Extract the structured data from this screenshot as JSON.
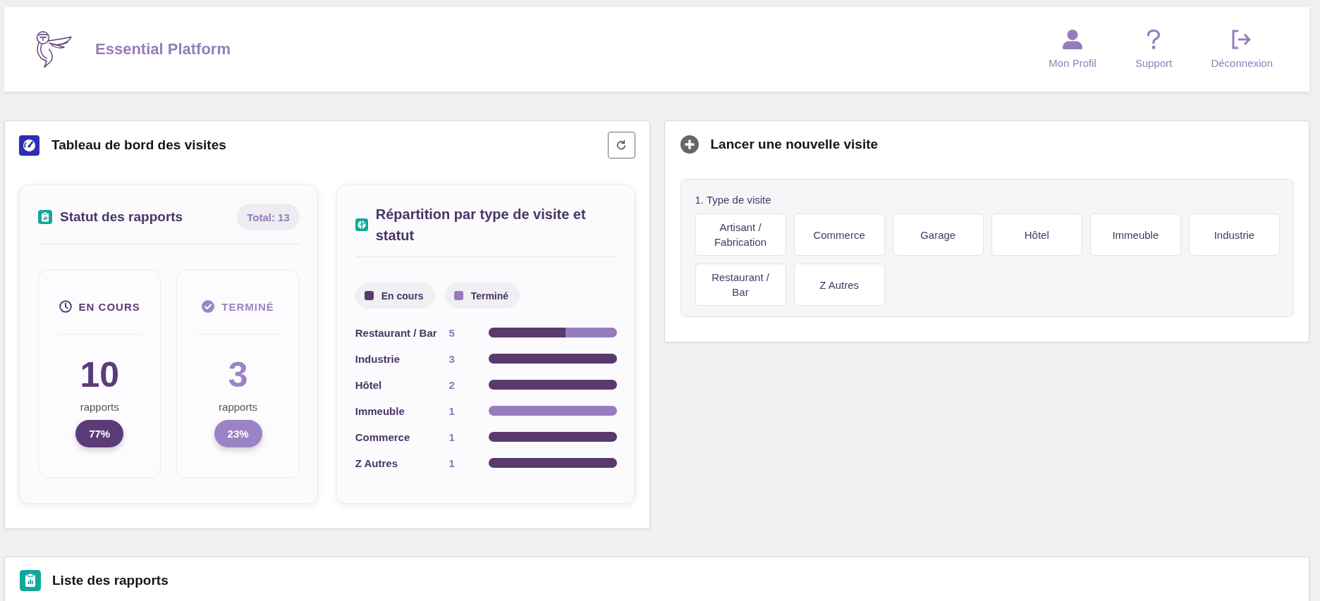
{
  "header": {
    "title": "Essential Platform",
    "nav": [
      {
        "kind": "profile",
        "label": "Mon Profil"
      },
      {
        "kind": "support",
        "label": "Support"
      },
      {
        "kind": "logout",
        "label": "Déconnexion"
      }
    ]
  },
  "dashboard": {
    "title": "Tableau de bord des visites",
    "status_panel": {
      "title": "Statut des rapports",
      "total": "Total: 13",
      "statuses": [
        {
          "kind": "in_progress",
          "label": "EN COURS",
          "count": "10",
          "unit": "rapports",
          "percent": "77%",
          "color": "#5b3c78"
        },
        {
          "kind": "done",
          "label": "TERMINÉ",
          "count": "3",
          "unit": "rapports",
          "percent": "23%",
          "color": "#9a84c5"
        }
      ]
    },
    "distribution_panel": {
      "title": "Répartition par type de visite et statut",
      "legend": [
        {
          "label": "En cours",
          "color": "#583b6c"
        },
        {
          "label": "Terminé",
          "color": "#957dbd"
        }
      ],
      "rows": [
        {
          "label": "Restaurant / Bar",
          "count": "5",
          "level": 0.6
        },
        {
          "label": "Industrie",
          "count": "3",
          "level": 1
        },
        {
          "label": "Hôtel",
          "count": "2",
          "level": 1
        },
        {
          "label": "Immeuble",
          "count": "1",
          "level": 0
        },
        {
          "label": "Commerce",
          "count": "1",
          "level": 1
        },
        {
          "label": "Z Autres",
          "count": "1",
          "level": 1
        }
      ]
    }
  },
  "new_visit": {
    "title": "Lancer une nouvelle visite",
    "step_label": "1. Type de visite",
    "options": [
      {
        "label": "Artisant / Fabrication",
        "selected": false
      },
      {
        "label": "Commerce",
        "selected": false
      },
      {
        "label": "Garage",
        "selected": false
      },
      {
        "label": "Hôtel",
        "selected": false
      },
      {
        "label": "Immeuble",
        "selected": false
      },
      {
        "label": "Industrie",
        "selected": false
      },
      {
        "label": "Restaurant / Bar",
        "selected": false
      },
      {
        "label": "Z Autres",
        "selected": false
      }
    ]
  },
  "reports_list": {
    "title": "Liste des rapports"
  }
}
